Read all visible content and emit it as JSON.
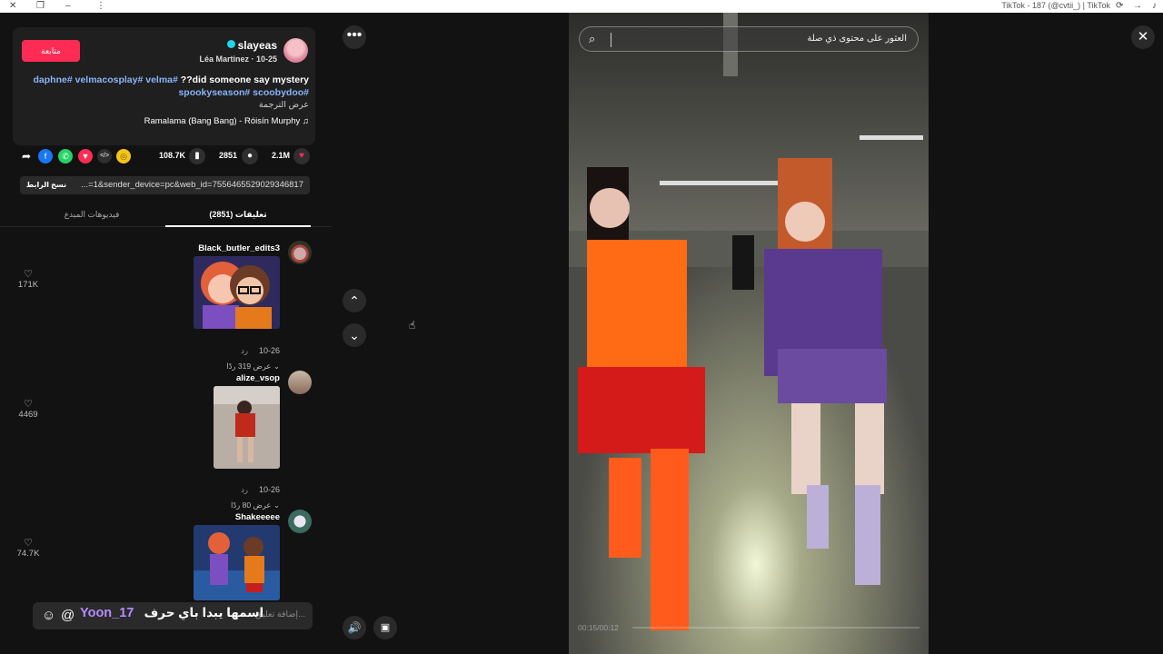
{
  "window": {
    "title": "TikTok - 187 (@cvtii_) | TikTok"
  },
  "post": {
    "follow_label": "متابعة",
    "username": "slayeas",
    "display_name": "Léa Martinez",
    "date": "10-25",
    "caption_line1": "daphne# velmacosplay# velma# ??did someone say mystery",
    "caption_hashtags1": "daphne# velmacosplay# velma#",
    "caption_text1": "??did someone say mystery",
    "caption_line2": "spookyseason# scoobydoo#",
    "translate_label": "عرض الترجمة",
    "music": "Ramalama (Bang Bang) - Róisín Murphy",
    "likes": "2.1M",
    "comments": "2851",
    "saves": "108.7K",
    "copy_link_label": "نسخ الرابط",
    "url": "...=1&sender_device=pc&web_id=7556465529029346817"
  },
  "tabs": {
    "comments": "تعليقات (2851)",
    "creator_videos": "فيديوهات المبدع"
  },
  "comments": [
    {
      "username": "Black_butler_edits3",
      "date": "10-26",
      "reply_label": "رد",
      "more_replies": "عرض 319 ردًا",
      "likes": "171K"
    },
    {
      "username": "alize_vsop",
      "date": "10-26",
      "reply_label": "رد",
      "more_replies": "عرض 80 ردًا",
      "likes": "4469"
    },
    {
      "username": "Shakeeeee",
      "likes": "74.7K"
    }
  ],
  "input": {
    "placeholder": "إضافة تعليق..."
  },
  "overlay": {
    "name": "Yoon_17",
    "text": "اسمها يبدا باي حرف"
  },
  "search": {
    "placeholder": "العثور على محتوى ذي صلة"
  },
  "video": {
    "time": "00:15/00:12"
  },
  "icons": {
    "more": "more-icon",
    "up": "chevron-up-icon",
    "down": "chevron-down-icon",
    "volume": "volume-icon",
    "pip": "mini-player-icon",
    "close": "close-icon"
  },
  "colors": {
    "accent": "#fe2c55",
    "verified": "#20d5ec",
    "hashtag": "#8ab4f8"
  }
}
